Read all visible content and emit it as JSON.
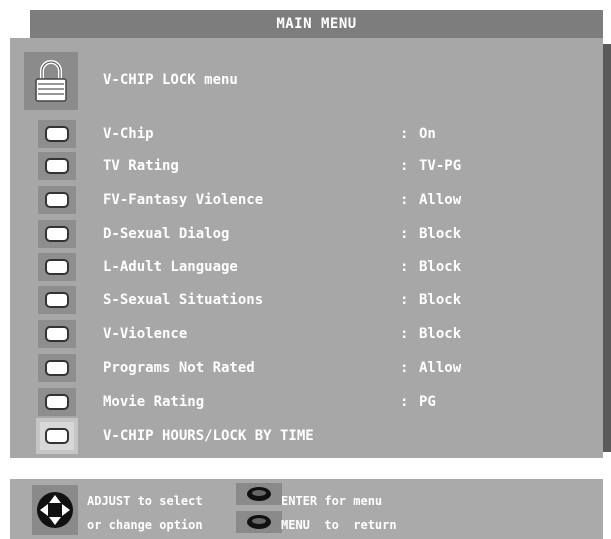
{
  "header": {
    "title": "MAIN MENU"
  },
  "section": {
    "title": "V-CHIP LOCK menu",
    "icon": "lock-icon"
  },
  "items": [
    {
      "label": "V-Chip",
      "separator": ":",
      "value": "On"
    },
    {
      "label": "TV Rating",
      "separator": ":",
      "value": "TV-PG"
    },
    {
      "label": "FV-Fantasy Violence",
      "separator": ":",
      "value": "Allow"
    },
    {
      "label": "D-Sexual Dialog",
      "separator": ":",
      "value": "Block"
    },
    {
      "label": "L-Adult Language",
      "separator": ":",
      "value": "Block"
    },
    {
      "label": "S-Sexual Situations",
      "separator": ":",
      "value": "Block"
    },
    {
      "label": "V-Violence",
      "separator": ":",
      "value": "Block"
    },
    {
      "label": "Programs Not Rated",
      "separator": ":",
      "value": "Allow"
    },
    {
      "label": "Movie Rating",
      "separator": ":",
      "value": "PG"
    },
    {
      "label": "V-CHIP HOURS/LOCK BY TIME",
      "separator": "",
      "value": ""
    }
  ],
  "help": {
    "adjust": "ADJUST to select",
    "change": "or change option",
    "enter": "ENTER for menu",
    "menu": "MENU  to  return"
  },
  "colors": {
    "panel": "#a7a7a7",
    "title_bar": "#7d7d7d",
    "text": "#ffffff",
    "selected_tile": "#d8d8d8"
  }
}
